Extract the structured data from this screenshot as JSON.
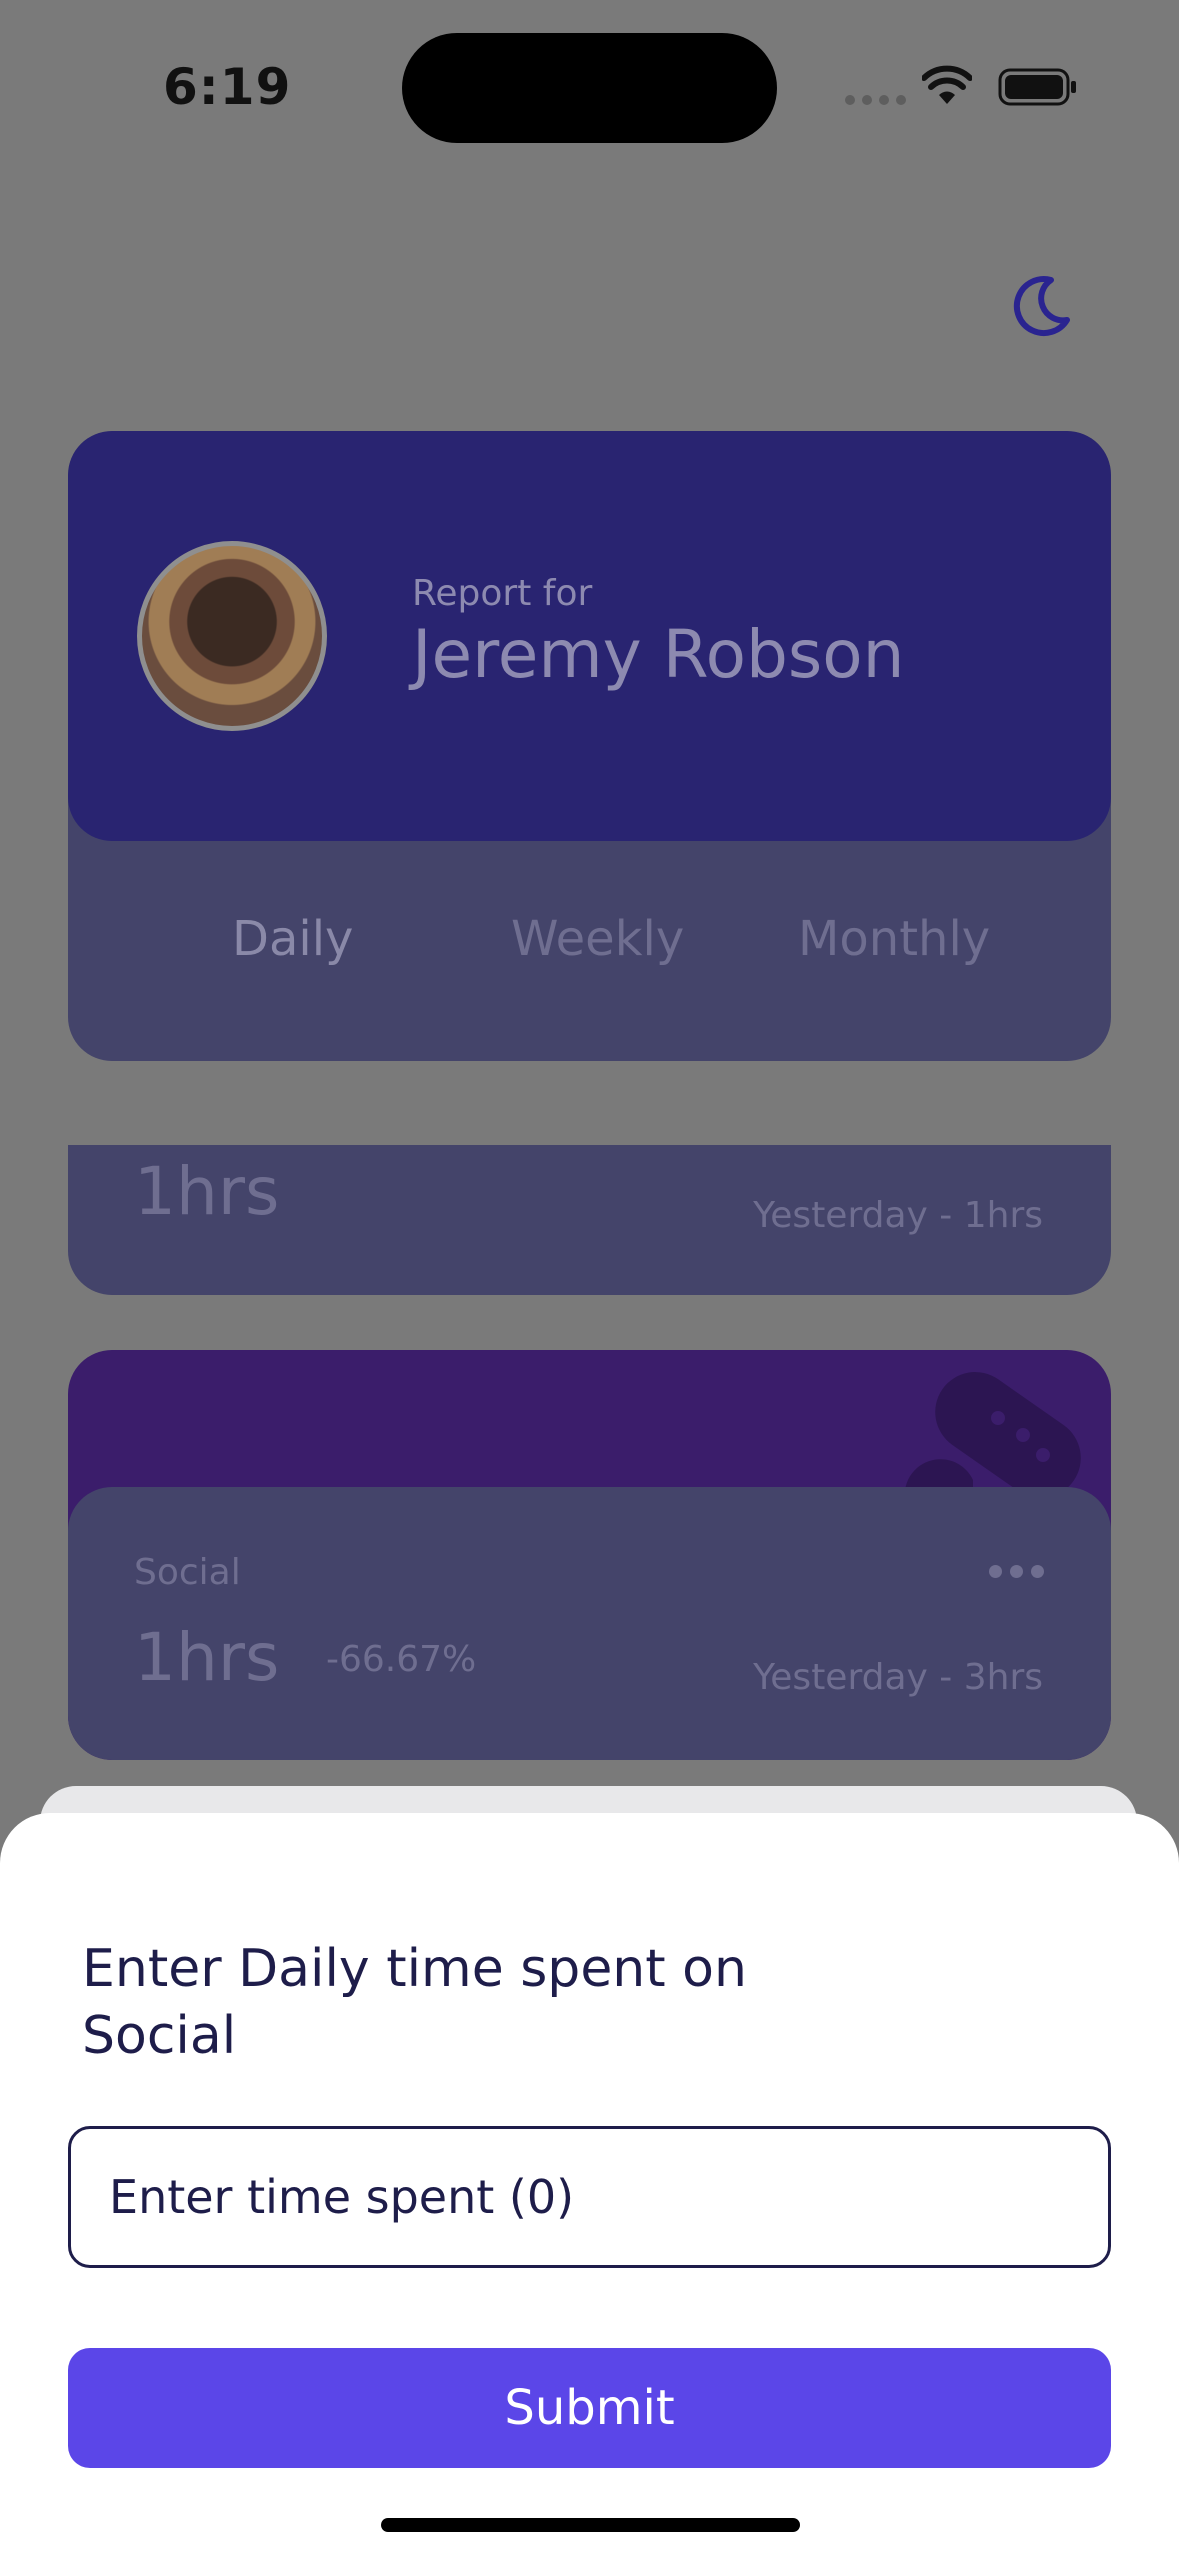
{
  "status_bar": {
    "time": "6:19"
  },
  "header": {
    "theme_icon": "moon-icon"
  },
  "profile": {
    "report_for": "Report for",
    "name": "Jeremy Robson",
    "tabs": [
      "Daily",
      "Weekly",
      "Monthly"
    ],
    "selected_tab": "Daily"
  },
  "activity_cards": [
    {
      "category": "",
      "hours": "1hrs",
      "previous": "Yesterday - 1hrs"
    },
    {
      "category": "Social",
      "icon": "gamepad-icon",
      "hours": "1hrs",
      "change": "-66.67%",
      "previous": "Yesterday - 3hrs",
      "accent": "#3b1d6b"
    }
  ],
  "sheet": {
    "title": "Enter Daily time spent on Social",
    "input_placeholder": "Enter time spent (0)",
    "submit_label": "Submit"
  },
  "colors": {
    "accent": "#5b46e8",
    "profile_header": "#292471",
    "text_dark": "#1e1d4a"
  }
}
